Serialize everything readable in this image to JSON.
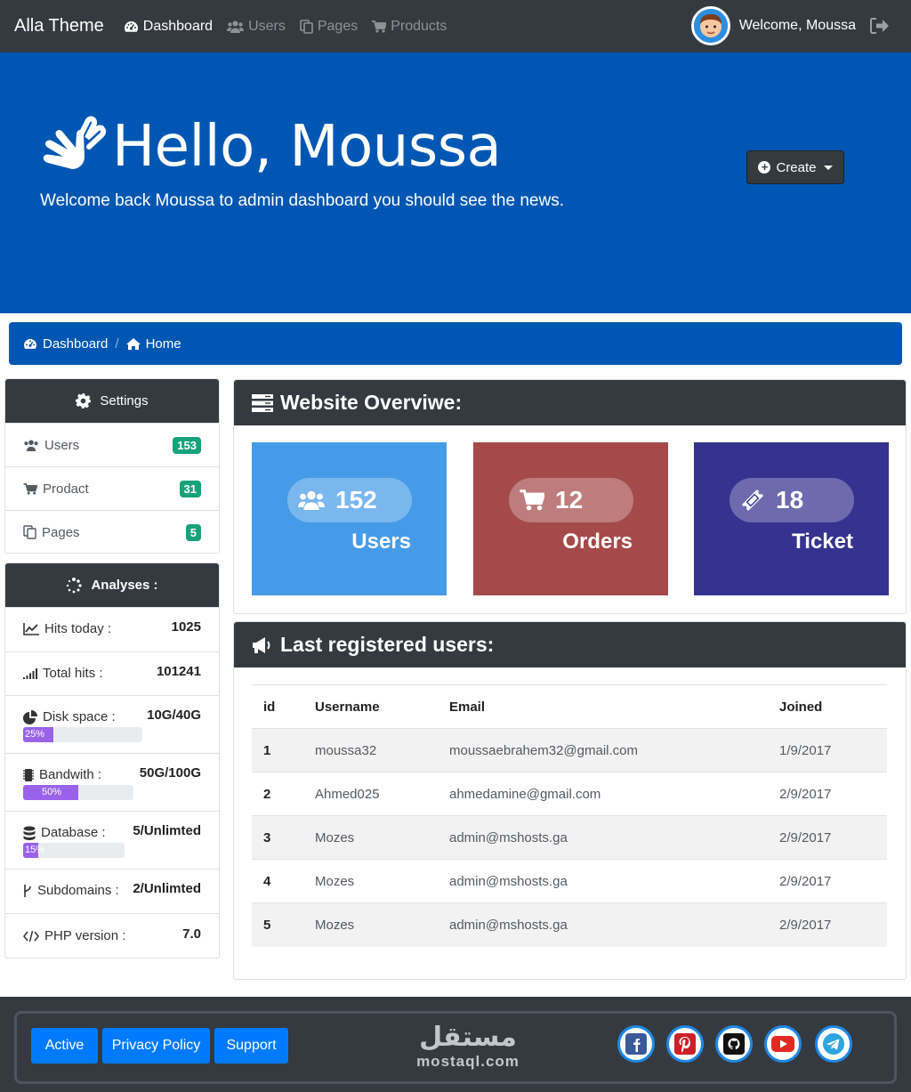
{
  "navbar": {
    "brand": "Alla Theme",
    "links": [
      {
        "label": "Dashboard",
        "icon": "dashboard-icon",
        "active": true
      },
      {
        "label": "Users",
        "icon": "users-icon",
        "active": false
      },
      {
        "label": "Pages",
        "icon": "pages-icon",
        "active": false
      },
      {
        "label": "Products",
        "icon": "cart-icon",
        "active": false
      }
    ],
    "welcome": "Welcome, Moussa"
  },
  "hero": {
    "title": "Hello, Moussa",
    "subtitle": "Welcome back Moussa to admin dashboard you should see the news.",
    "create_label": "Create"
  },
  "breadcrumb": {
    "items": [
      "Dashboard",
      "Home"
    ]
  },
  "settings": {
    "title": "Settings",
    "items": [
      {
        "label": "Users",
        "count": "153",
        "icon": "users-icon"
      },
      {
        "label": "Prodact",
        "count": "31",
        "icon": "cart-icon"
      },
      {
        "label": "Pages",
        "count": "5",
        "icon": "pages-icon"
      }
    ]
  },
  "analyses": {
    "title": "Analyses :",
    "rows": [
      {
        "label": "Hits today :",
        "value": "1025",
        "icon": "line-chart-icon"
      },
      {
        "label": "Total hits :",
        "value": "101241",
        "icon": "signal-icon"
      },
      {
        "label": "Disk space :",
        "value": "10G/40G",
        "icon": "pie-chart-icon",
        "progress": "25%"
      },
      {
        "label": "Bandwith :",
        "value": "50G/100G",
        "icon": "memory-icon",
        "progress": "50%"
      },
      {
        "label": "Database :",
        "value": "5/Unlimted",
        "icon": "database-icon",
        "progress": "15%"
      },
      {
        "label": "Subdomains :",
        "value": "2/Unlimted",
        "icon": "branch-icon"
      },
      {
        "label": "PHP version :",
        "value": "7.0",
        "icon": "code-icon"
      }
    ]
  },
  "overview": {
    "title": "Website Overviwe:",
    "stats": [
      {
        "value": "152",
        "label": "Users",
        "color": "#469be8",
        "icon": "users-icon"
      },
      {
        "value": "12",
        "label": "Orders",
        "color": "#a54a4a",
        "icon": "cart-icon"
      },
      {
        "value": "18",
        "label": "Ticket",
        "color": "#35338f",
        "icon": "ticket-icon"
      }
    ]
  },
  "users_table": {
    "title": "Last registered users:",
    "columns": [
      "id",
      "Username",
      "Email",
      "Joined"
    ],
    "rows": [
      [
        "1",
        "moussa32",
        "moussaebrahem32@gmail.com",
        "1/9/2017"
      ],
      [
        "2",
        "Ahmed025",
        "ahmedamine@gmail.com",
        "2/9/2017"
      ],
      [
        "3",
        "Mozes",
        "admin@mshosts.ga",
        "2/9/2017"
      ],
      [
        "4",
        "Mozes",
        "admin@mshosts.ga",
        "2/9/2017"
      ],
      [
        "5",
        "Mozes",
        "admin@mshosts.ga",
        "2/9/2017"
      ]
    ]
  },
  "footer": {
    "buttons": [
      "Active",
      "Privacy Policy",
      "Support"
    ],
    "watermark_arabic": "مستقل",
    "watermark_latin": "mostaql.com",
    "social": [
      "facebook-icon",
      "pinterest-icon",
      "github-icon",
      "youtube-icon",
      "telegram-icon"
    ]
  }
}
